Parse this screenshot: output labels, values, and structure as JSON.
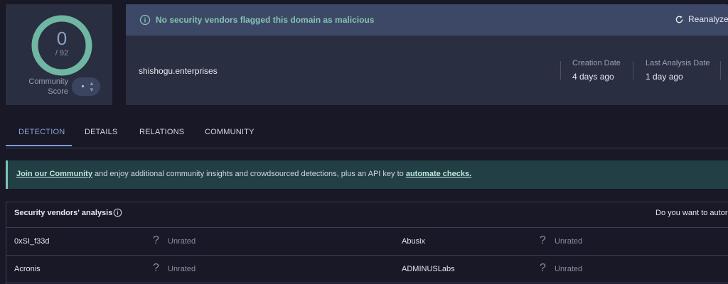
{
  "score": {
    "value": "0",
    "total": "/ 92",
    "community_label_line1": "Community",
    "community_label_line2": "Score",
    "ring_color": "#6fb6a3"
  },
  "header": {
    "banner_text": "No security vendors flagged this domain as malicious",
    "reanalyze_label": "Reanalyze",
    "domain": "shishogu.enterprises",
    "creation_label": "Creation Date",
    "creation_value": "4 days ago",
    "last_analysis_label": "Last Analysis Date",
    "last_analysis_value": "1 day ago"
  },
  "tabs": [
    {
      "label": "DETECTION",
      "active": true
    },
    {
      "label": "DETAILS",
      "active": false
    },
    {
      "label": "RELATIONS",
      "active": false
    },
    {
      "label": "COMMUNITY",
      "active": false
    }
  ],
  "community_banner": {
    "link1": "Join our Community",
    "middle": " and enjoy additional community insights and crowdsourced detections, plus an API key to ",
    "link2": "automate checks."
  },
  "vendors": {
    "title": "Security vendors' analysis",
    "question": "Do you want to autor",
    "rows": [
      {
        "left_name": "0xSI_f33d",
        "left_status": "Unrated",
        "right_name": "Abusix",
        "right_status": "Unrated"
      },
      {
        "left_name": "Acronis",
        "left_status": "Unrated",
        "right_name": "ADMINUSLabs",
        "right_status": "Unrated"
      }
    ]
  },
  "colors": {
    "accent": "#7f9bd6",
    "clean": "#86c3b1",
    "background": "#181826"
  }
}
